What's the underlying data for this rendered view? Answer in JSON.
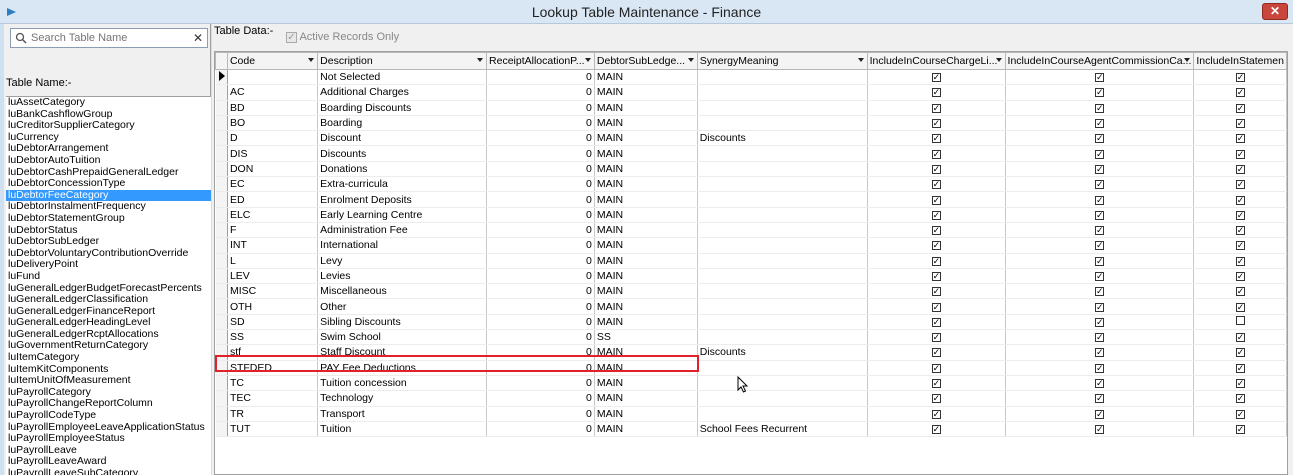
{
  "window": {
    "title": "Lookup Table Maintenance - Finance",
    "close_label": "✕"
  },
  "left": {
    "search_placeholder": "Search Table Name",
    "table_name_label": "Table Name:-",
    "items": [
      "luAssetCategory",
      "luBankCashflowGroup",
      "luCreditorSupplierCategory",
      "luCurrency",
      "luDebtorArrangement",
      "luDebtorAutoTuition",
      "luDebtorCashPrepaidGeneralLedger",
      "luDebtorConcessionType",
      "luDebtorFeeCategory",
      "luDebtorInstalmentFrequency",
      "luDebtorStatementGroup",
      "luDebtorStatus",
      "luDebtorSubLedger",
      "luDebtorVoluntaryContributionOverride",
      "luDeliveryPoint",
      "luFund",
      "luGeneralLedgerBudgetForecastPercents",
      "luGeneralLedgerClassification",
      "luGeneralLedgerFinanceReport",
      "luGeneralLedgerHeadingLevel",
      "luGeneralLedgerRcptAllocations",
      "luGovernmentReturnCategory",
      "luItemCategory",
      "luItemKitComponents",
      "luItemUnitOfMeasurement",
      "luPayrollCategory",
      "luPayrollChangeReportColumn",
      "luPayrollCodeType",
      "luPayrollEmployeeLeaveApplicationStatus",
      "luPayrollEmployeeStatus",
      "luPayrollLeave",
      "luPayrollLeaveAward",
      "luPayrollLeaveSubCategory"
    ],
    "selected_index": 8
  },
  "right": {
    "table_data_label": "Table Data:-",
    "active_records_label": "Active Records Only",
    "columns": [
      "Code",
      "Description",
      "ReceiptAllocationP...",
      "DebtorSubLedge...",
      "SynergyMeaning",
      "IncludeInCourseChargeLi...",
      "IncludeInCourseAgentCommissionCa...",
      "IncludeInStatemen"
    ],
    "rows": [
      {
        "code": "",
        "desc": "Not Selected",
        "alloc": "0",
        "ledger": "MAIN",
        "meaning": ""
      },
      {
        "code": "AC",
        "desc": "Additional Charges",
        "alloc": "0",
        "ledger": "MAIN",
        "meaning": ""
      },
      {
        "code": "BD",
        "desc": "Boarding Discounts",
        "alloc": "0",
        "ledger": "MAIN",
        "meaning": ""
      },
      {
        "code": "BO",
        "desc": "Boarding",
        "alloc": "0",
        "ledger": "MAIN",
        "meaning": ""
      },
      {
        "code": "D",
        "desc": "Discount",
        "alloc": "0",
        "ledger": "MAIN",
        "meaning": "Discounts"
      },
      {
        "code": "DIS",
        "desc": "Discounts",
        "alloc": "0",
        "ledger": "MAIN",
        "meaning": ""
      },
      {
        "code": "DON",
        "desc": "Donations",
        "alloc": "0",
        "ledger": "MAIN",
        "meaning": ""
      },
      {
        "code": "EC",
        "desc": "Extra-curricula",
        "alloc": "0",
        "ledger": "MAIN",
        "meaning": ""
      },
      {
        "code": "ED",
        "desc": "Enrolment Deposits",
        "alloc": "0",
        "ledger": "MAIN",
        "meaning": ""
      },
      {
        "code": "ELC",
        "desc": "Early Learning Centre",
        "alloc": "0",
        "ledger": "MAIN",
        "meaning": ""
      },
      {
        "code": "F",
        "desc": "Administration Fee",
        "alloc": "0",
        "ledger": "MAIN",
        "meaning": ""
      },
      {
        "code": "INT",
        "desc": "International",
        "alloc": "0",
        "ledger": "MAIN",
        "meaning": ""
      },
      {
        "code": "L",
        "desc": "Levy",
        "alloc": "0",
        "ledger": "MAIN",
        "meaning": ""
      },
      {
        "code": "LEV",
        "desc": "Levies",
        "alloc": "0",
        "ledger": "MAIN",
        "meaning": ""
      },
      {
        "code": "MISC",
        "desc": "Miscellaneous",
        "alloc": "0",
        "ledger": "MAIN",
        "meaning": ""
      },
      {
        "code": "OTH",
        "desc": "Other",
        "alloc": "0",
        "ledger": "MAIN",
        "meaning": ""
      },
      {
        "code": "SD",
        "desc": "Sibling Discounts",
        "alloc": "0",
        "ledger": "MAIN",
        "meaning": ""
      },
      {
        "code": "SS",
        "desc": "Swim School",
        "alloc": "0",
        "ledger": "SS",
        "meaning": ""
      },
      {
        "code": "stf",
        "desc": "Staff Discount",
        "alloc": "0",
        "ledger": "MAIN",
        "meaning": "Discounts"
      },
      {
        "code": "STFDED",
        "desc": "PAY Fee Deductions",
        "alloc": "0",
        "ledger": "MAIN",
        "meaning": ""
      },
      {
        "code": "TC",
        "desc": "Tuition concession",
        "alloc": "0",
        "ledger": "MAIN",
        "meaning": ""
      },
      {
        "code": "TEC",
        "desc": "Technology",
        "alloc": "0",
        "ledger": "MAIN",
        "meaning": ""
      },
      {
        "code": "TR",
        "desc": "Transport",
        "alloc": "0",
        "ledger": "MAIN",
        "meaning": ""
      },
      {
        "code": "TUT",
        "desc": "Tuition",
        "alloc": "0",
        "ledger": "MAIN",
        "meaning": "School Fees Recurrent"
      }
    ],
    "unchecked_last_col_rows": [
      16
    ]
  },
  "colors": {
    "accent": "#3399ff",
    "highlight": "#e0202a",
    "close": "#c9463d"
  }
}
